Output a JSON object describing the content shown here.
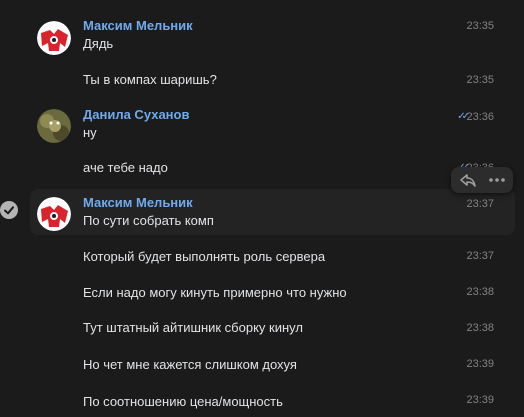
{
  "colors": {
    "background": "#1b1b1b",
    "name": "#71aaeb",
    "text": "#e1e3e6",
    "time": "#828282"
  },
  "messages": [
    {
      "author": "Максим Мельник",
      "text": "Дядь",
      "time": "23:35",
      "avatar": "maksim-avatar"
    },
    {
      "text": "Ты в компах шаришь?",
      "time": "23:35"
    },
    {
      "author": "Данила Суханов",
      "text": "ну",
      "time": "23:36",
      "avatar": "danila-avatar",
      "read": true
    },
    {
      "text": "аче тебе надо",
      "time": "23:36",
      "read": true
    },
    {
      "author": "Максим Мельник",
      "text": "По сути собрать комп",
      "time": "23:37",
      "avatar": "maksim-avatar"
    },
    {
      "text": "Который будет выполнять роль сервера",
      "time": "23:37"
    },
    {
      "text": "Если надо могу кинуть примерно что нужно",
      "time": "23:38"
    },
    {
      "text": "Тут штатный айтишник сборку кинул",
      "time": "23:38"
    },
    {
      "text": "Но чет мне кажется слишком дохуя",
      "time": "23:39"
    },
    {
      "text": "По соотношению цена/мощность",
      "time": "23:39"
    }
  ],
  "icons": {
    "read": "double-check-icon",
    "select": "checkmark-circle-icon",
    "reply": "reply-icon",
    "more": "more-icon"
  }
}
